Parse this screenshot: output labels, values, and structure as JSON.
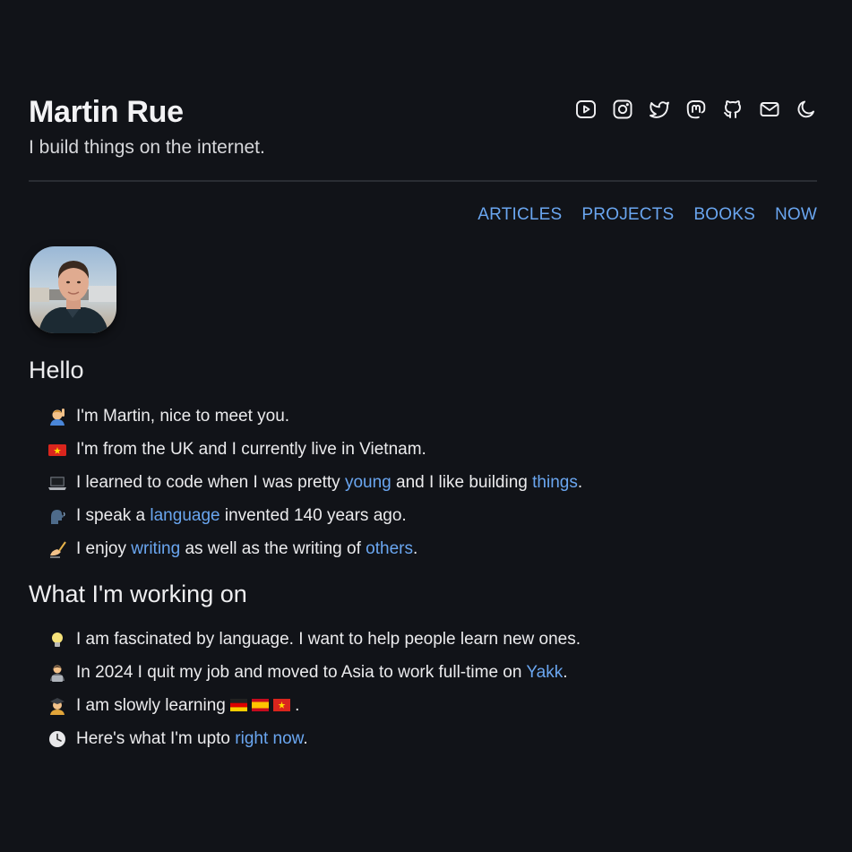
{
  "header": {
    "title": "Martin Rue",
    "tagline": "I build things on the internet."
  },
  "social_icons": [
    "youtube-icon",
    "instagram-icon",
    "twitter-icon",
    "mastodon-icon",
    "github-icon",
    "mail-icon",
    "moon-icon"
  ],
  "nav": {
    "articles": "ARTICLES",
    "projects": "PROJECTS",
    "books": "BOOKS",
    "now": "NOW"
  },
  "hello": {
    "heading": "Hello",
    "items": [
      {
        "icon": "person-raising-hand-emoji",
        "parts": [
          "I'm Martin, nice to meet you."
        ]
      },
      {
        "icon": "vietnam-flag-emoji",
        "parts": [
          "I'm from the UK and I currently live in Vietnam."
        ]
      },
      {
        "icon": "laptop-emoji",
        "parts": [
          "I learned to code when I was pretty ",
          "young",
          " and I like building ",
          "things",
          "."
        ]
      },
      {
        "icon": "speaking-head-emoji",
        "parts": [
          "I speak a ",
          "language",
          " invented 140 years ago."
        ]
      },
      {
        "icon": "writing-hand-emoji",
        "parts": [
          "I enjoy ",
          "writing",
          " as well as the writing of ",
          "others",
          "."
        ]
      }
    ]
  },
  "work": {
    "heading": "What I'm working on",
    "items": [
      {
        "icon": "light-bulb-emoji",
        "parts": [
          "I am fascinated by language. I want to help people learn new ones."
        ]
      },
      {
        "icon": "technologist-emoji",
        "parts": [
          "In 2024 I quit my job and moved to Asia to work full-time on ",
          "Yakk",
          "."
        ]
      },
      {
        "icon": "student-emoji",
        "parts": [
          "I am slowly learning ",
          "."
        ],
        "flags": [
          "germany-flag-emoji",
          "spain-flag-emoji",
          "vietnam-flag-emoji"
        ]
      },
      {
        "icon": "clock-emoji",
        "parts": [
          "Here's what I'm upto ",
          "right now",
          "."
        ]
      }
    ]
  },
  "colors": {
    "background": "#111318",
    "link": "#6aa6f0",
    "text": "#ebebed"
  }
}
